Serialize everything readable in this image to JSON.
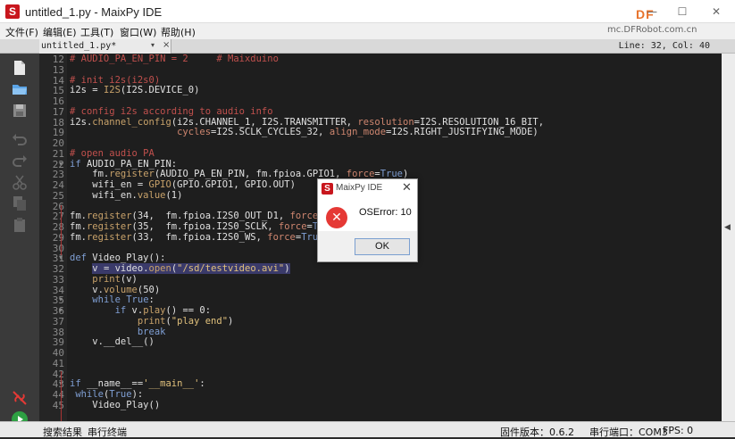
{
  "window": {
    "title": "untitled_1.py - MaixPy IDE",
    "icon_letter": "S",
    "watermark": "DF",
    "watermark_sub": "mc.DFRobot.com.cn"
  },
  "menu": [
    "文件(F)",
    "编辑(E)",
    "工具(T)",
    "窗口(W)",
    "帮助(H)"
  ],
  "tab": {
    "name": "untitled_1.py*",
    "dropdown": "▾",
    "close": "×"
  },
  "cursor_position": "Line: 32, Col: 40",
  "code": {
    "line_numbers": [
      "12",
      "13",
      "14",
      "15",
      "16",
      "17",
      "18",
      "19",
      "20",
      "21",
      "22",
      "23",
      "24",
      "25",
      "26",
      "27",
      "28",
      "29",
      "30",
      "31",
      "32",
      "33",
      "34",
      "35",
      "36",
      "37",
      "38",
      "39",
      "40",
      "41",
      "42",
      "43",
      "44",
      "45"
    ],
    "lines": [
      "# AUDIO_PA_EN_PIN = 2     # Maixduino",
      "",
      "# init i2s(i2s0)",
      "i2s = I2S(I2S.DEVICE_0)",
      "",
      "# config i2s according to audio info",
      "i2s.channel_config(i2s.CHANNEL_1, I2S.TRANSMITTER, resolution=I2S.RESOLUTION_16_BIT,",
      "                   cycles=I2S.SCLK_CYCLES_32, align_mode=I2S.RIGHT_JUSTIFYING_MODE)",
      "",
      "# open audio PA",
      "if AUDIO_PA_EN_PIN:",
      "    fm.register(AUDIO_PA_EN_PIN, fm.fpioa.GPIO1, force=True)",
      "    wifi_en = GPIO(GPIO.GPIO1, GPIO.OUT)",
      "    wifi_en.value(1)",
      "",
      "fm.register(34,  fm.fpioa.I2S0_OUT_D1, force=True)",
      "fm.register(35,  fm.fpioa.I2S0_SCLK, force=True)",
      "fm.register(33,  fm.fpioa.I2S0_WS, force=True)",
      "",
      "def Video_Play():",
      "    v = video.open(\"/sd/testvideo.avi\")",
      "    print(v)",
      "    v.volume(50)",
      "    while True:",
      "        if v.play() == 0:",
      "            print(\"play end\")",
      "            break",
      "    v.__del__()",
      "",
      "",
      "",
      "if __name__=='__main__':",
      " while(True):",
      "    Video_Play()"
    ]
  },
  "dialog": {
    "title": "MaixPy IDE",
    "message": "OSError: 10",
    "ok": "OK",
    "icon": "error-icon",
    "close": "✕"
  },
  "status": {
    "search_results": "搜索结果",
    "serial_terminal": "串行终端",
    "firmware_label": "固件版本：0.6.2",
    "serial_port": "串行端口：COM3",
    "fps": "FPS: 0"
  },
  "toolbar_icons": [
    "new-file-icon",
    "open-folder-icon",
    "save-icon",
    "undo-icon",
    "redo-icon",
    "cut-icon",
    "copy-icon",
    "paste-icon",
    "disconnect-icon",
    "run-icon"
  ],
  "colors": {
    "accent_red": "#c8161d",
    "run_green": "#2ea043",
    "editor_bg": "#1e1e1e"
  }
}
